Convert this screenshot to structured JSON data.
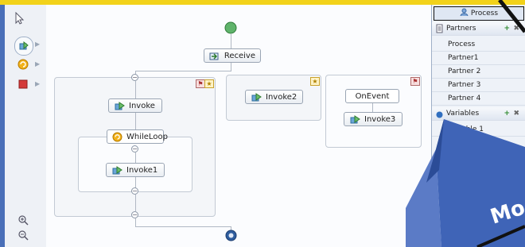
{
  "canvas": {
    "nodes": {
      "receive": "Receive",
      "invoke": "Invoke",
      "whileloop": "WhileLoop",
      "invoke1": "Invoke1",
      "invoke2": "Invoke2",
      "onevent": "OnEvent",
      "invoke3": "Invoke3"
    }
  },
  "panel": {
    "tab_label": "Process",
    "partners_header": "Partners",
    "partners": [
      "Process",
      "Partner1",
      "Partner 2",
      "Partner 3",
      "Partner 4"
    ],
    "variables_header": "Variables",
    "variables": [
      "Variable 1"
    ]
  },
  "overlay": {
    "cube_text": "Mo"
  },
  "colors": {
    "top_bar": "#f2d21a",
    "frame_blue": "#3a5fae",
    "cube_blue": "#3f64b7"
  }
}
